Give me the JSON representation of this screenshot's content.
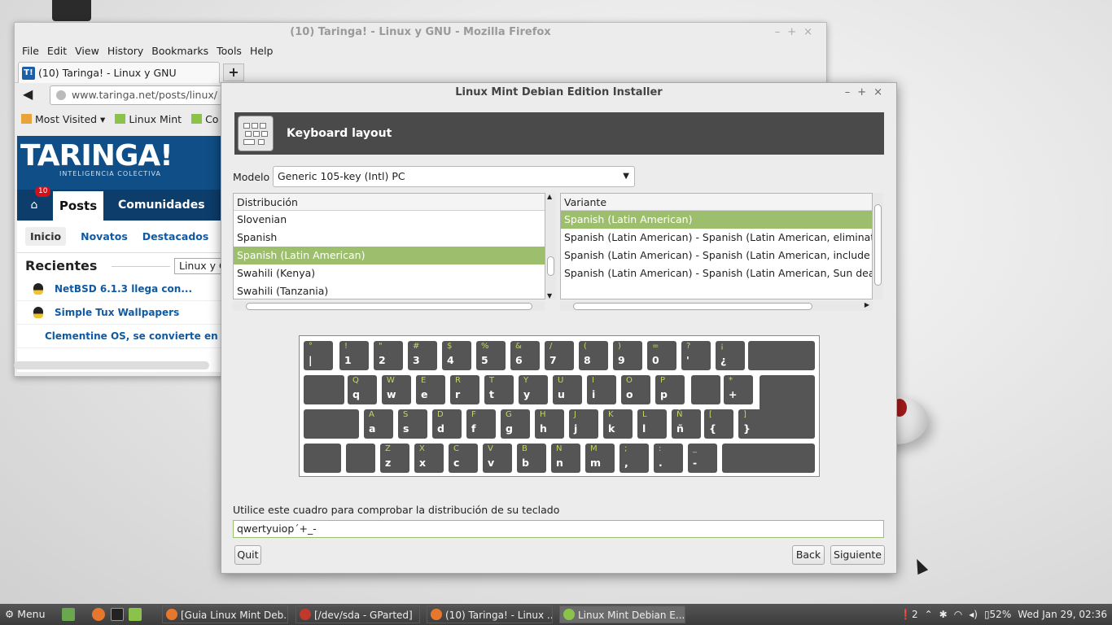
{
  "firefox": {
    "title": "(10) Taringa! - Linux y GNU - Mozilla Firefox",
    "menu": [
      "File",
      "Edit",
      "View",
      "History",
      "Bookmarks",
      "Tools",
      "Help"
    ],
    "tab_label": "(10) Taringa! - Linux y GNU",
    "tab_favicon": "T!",
    "url": "www.taringa.net/posts/linux/",
    "bookmarks": [
      "Most Visited ▾",
      "Linux Mint",
      "Co"
    ],
    "page": {
      "logo": "TARINGA!",
      "logo_sub": "INTELIGENCIA COLECTIVA",
      "badge": "10",
      "nav_active": "Posts",
      "nav_next": "Comunidades",
      "subnav": [
        "Inicio",
        "Novatos",
        "Destacados"
      ],
      "recent_title": "Recientes",
      "recent_select": "Linux y G",
      "recent_items": [
        "NetBSD 6.1.3 llega con...",
        "Simple Tux Wallpapers",
        "Clementine OS, se convierte en la re"
      ]
    }
  },
  "installer": {
    "title": "Linux Mint Debian Edition Installer",
    "header_title": "Keyboard layout",
    "model_label": "Modelo",
    "model_value": "Generic 105-key (Intl) PC",
    "dist_header": "Distribución",
    "dist_rows": [
      "Slovenian",
      "Spanish",
      "Spanish (Latin American)",
      "Swahili (Kenya)",
      "Swahili (Tanzania)"
    ],
    "dist_selected": 2,
    "var_header": "Variante",
    "var_rows": [
      "Spanish (Latin American)",
      "Spanish (Latin American) - Spanish (Latin American, eliminate",
      "Spanish (Latin American) - Spanish (Latin American, include d",
      "Spanish (Latin American) - Spanish (Latin American, Sun dead"
    ],
    "var_selected": 0,
    "keyboard_rows": [
      [
        [
          "°",
          "|"
        ],
        [
          "!",
          "1"
        ],
        [
          "\"",
          "2"
        ],
        [
          "#",
          "3"
        ],
        [
          "$",
          "4"
        ],
        [
          "%",
          "5"
        ],
        [
          "&",
          "6"
        ],
        [
          "/",
          "7"
        ],
        [
          "(",
          "8"
        ],
        [
          ")",
          "9"
        ],
        [
          "=",
          "0"
        ],
        [
          "?",
          "'"
        ],
        [
          "¡",
          "¿"
        ],
        [
          "",
          ""
        ]
      ],
      [
        [
          "",
          ""
        ],
        [
          "Q",
          "q"
        ],
        [
          "W",
          "w"
        ],
        [
          "E",
          "e"
        ],
        [
          "R",
          "r"
        ],
        [
          "T",
          "t"
        ],
        [
          "Y",
          "y"
        ],
        [
          "U",
          "u"
        ],
        [
          "I",
          "i"
        ],
        [
          "O",
          "o"
        ],
        [
          "P",
          "p"
        ],
        [
          "",
          ""
        ],
        [
          "*",
          "+"
        ],
        [
          "",
          ""
        ]
      ],
      [
        [
          "",
          ""
        ],
        [
          "A",
          "a"
        ],
        [
          "S",
          "s"
        ],
        [
          "D",
          "d"
        ],
        [
          "F",
          "f"
        ],
        [
          "G",
          "g"
        ],
        [
          "H",
          "h"
        ],
        [
          "J",
          "j"
        ],
        [
          "K",
          "k"
        ],
        [
          "L",
          "l"
        ],
        [
          "Ñ",
          "ñ"
        ],
        [
          "[",
          "{"
        ],
        [
          "]",
          "}"
        ],
        [
          "",
          ""
        ]
      ],
      [
        [
          "",
          ""
        ],
        [
          "",
          ""
        ],
        [
          "Z",
          "z"
        ],
        [
          "X",
          "x"
        ],
        [
          "C",
          "c"
        ],
        [
          "V",
          "v"
        ],
        [
          "B",
          "b"
        ],
        [
          "N",
          "n"
        ],
        [
          "M",
          "m"
        ],
        [
          ";",
          ","
        ],
        [
          ":",
          "."
        ],
        [
          "_",
          "-"
        ],
        [
          "",
          ""
        ]
      ]
    ],
    "test_label": "Utilice este cuadro para comprobar la distribución de su teclado",
    "test_value": "qwertyuiop´+_-",
    "quit": "Quit",
    "back": "Back",
    "next": "Siguiente"
  },
  "taskbar": {
    "menu": "Menu",
    "windows": [
      "[Guia Linux Mint Deb...",
      "[/dev/sda - GParted]",
      "(10) Taringa! - Linux ...",
      "Linux Mint Debian E..."
    ],
    "active_window": 3,
    "tray_notif": "2",
    "battery": "52%",
    "clock": "Wed Jan 29, 02:36"
  },
  "colors": {
    "selection": "#9dbf6d",
    "key_alt": "#c2d860",
    "taringa": "#0f4e86"
  }
}
